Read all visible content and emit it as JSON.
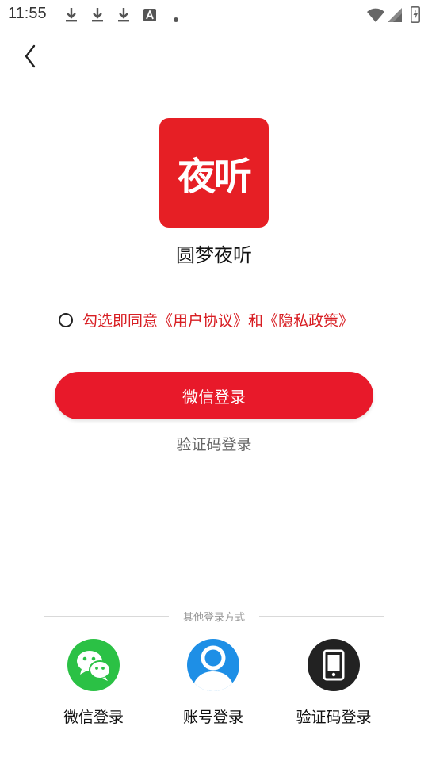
{
  "status_bar": {
    "time": "11:55",
    "icons": [
      "download-icon",
      "download-icon",
      "download-icon",
      "font-app-icon",
      "dot-icon",
      "wifi-icon",
      "signal-icon",
      "battery-charging-icon"
    ]
  },
  "nav": {
    "back_icon": "chevron-left-icon"
  },
  "app": {
    "logo_text": "夜听",
    "name": "圆梦夜听",
    "brand_color": "#e61f25"
  },
  "agreement": {
    "text": "勾选即同意《用户协议》和《隐私政策》",
    "checked": false
  },
  "primary_login": {
    "label": "微信登录"
  },
  "code_login_link": {
    "label": "验证码登录"
  },
  "other_login": {
    "title": "其他登录方式",
    "options": [
      {
        "label": "微信登录",
        "icon": "wechat-icon",
        "color": "#2bc145"
      },
      {
        "label": "账号登录",
        "icon": "user-icon",
        "color": "#1e8fe6"
      },
      {
        "label": "验证码登录",
        "icon": "phone-icon",
        "color": "#222222"
      }
    ]
  }
}
